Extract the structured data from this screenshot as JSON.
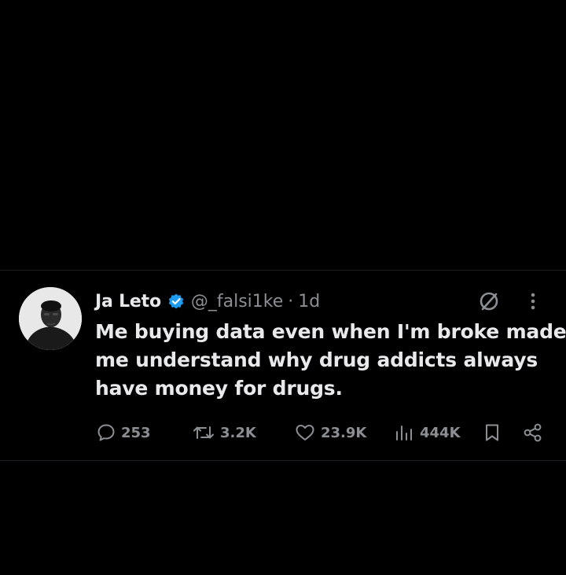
{
  "tweet": {
    "author_name": "Ja Leto",
    "handle": "@_falsi1ke",
    "separator": "·",
    "time": "1d",
    "text_lines": [
      "Me buying data even when I'm broke made",
      "me understand why drug addicts always",
      "have money for drugs."
    ],
    "avatar_icon": "profile-photo",
    "verified_icon": "verified-badge-icon",
    "verified_color": "#1d9bf0"
  },
  "actions": {
    "replies": "253",
    "reposts": "3.2K",
    "likes": "23.9K",
    "views": "444K",
    "icons": [
      "reply-icon",
      "repost-icon",
      "like-icon",
      "views-icon",
      "bookmark-icon",
      "share-icon"
    ]
  },
  "header_icons": [
    "grok-icon",
    "more-icon"
  ],
  "colors": {
    "background": "#000000",
    "text": "#e7e9ea",
    "secondary_text": "#8b8f94",
    "divider": "#1d1f23"
  }
}
